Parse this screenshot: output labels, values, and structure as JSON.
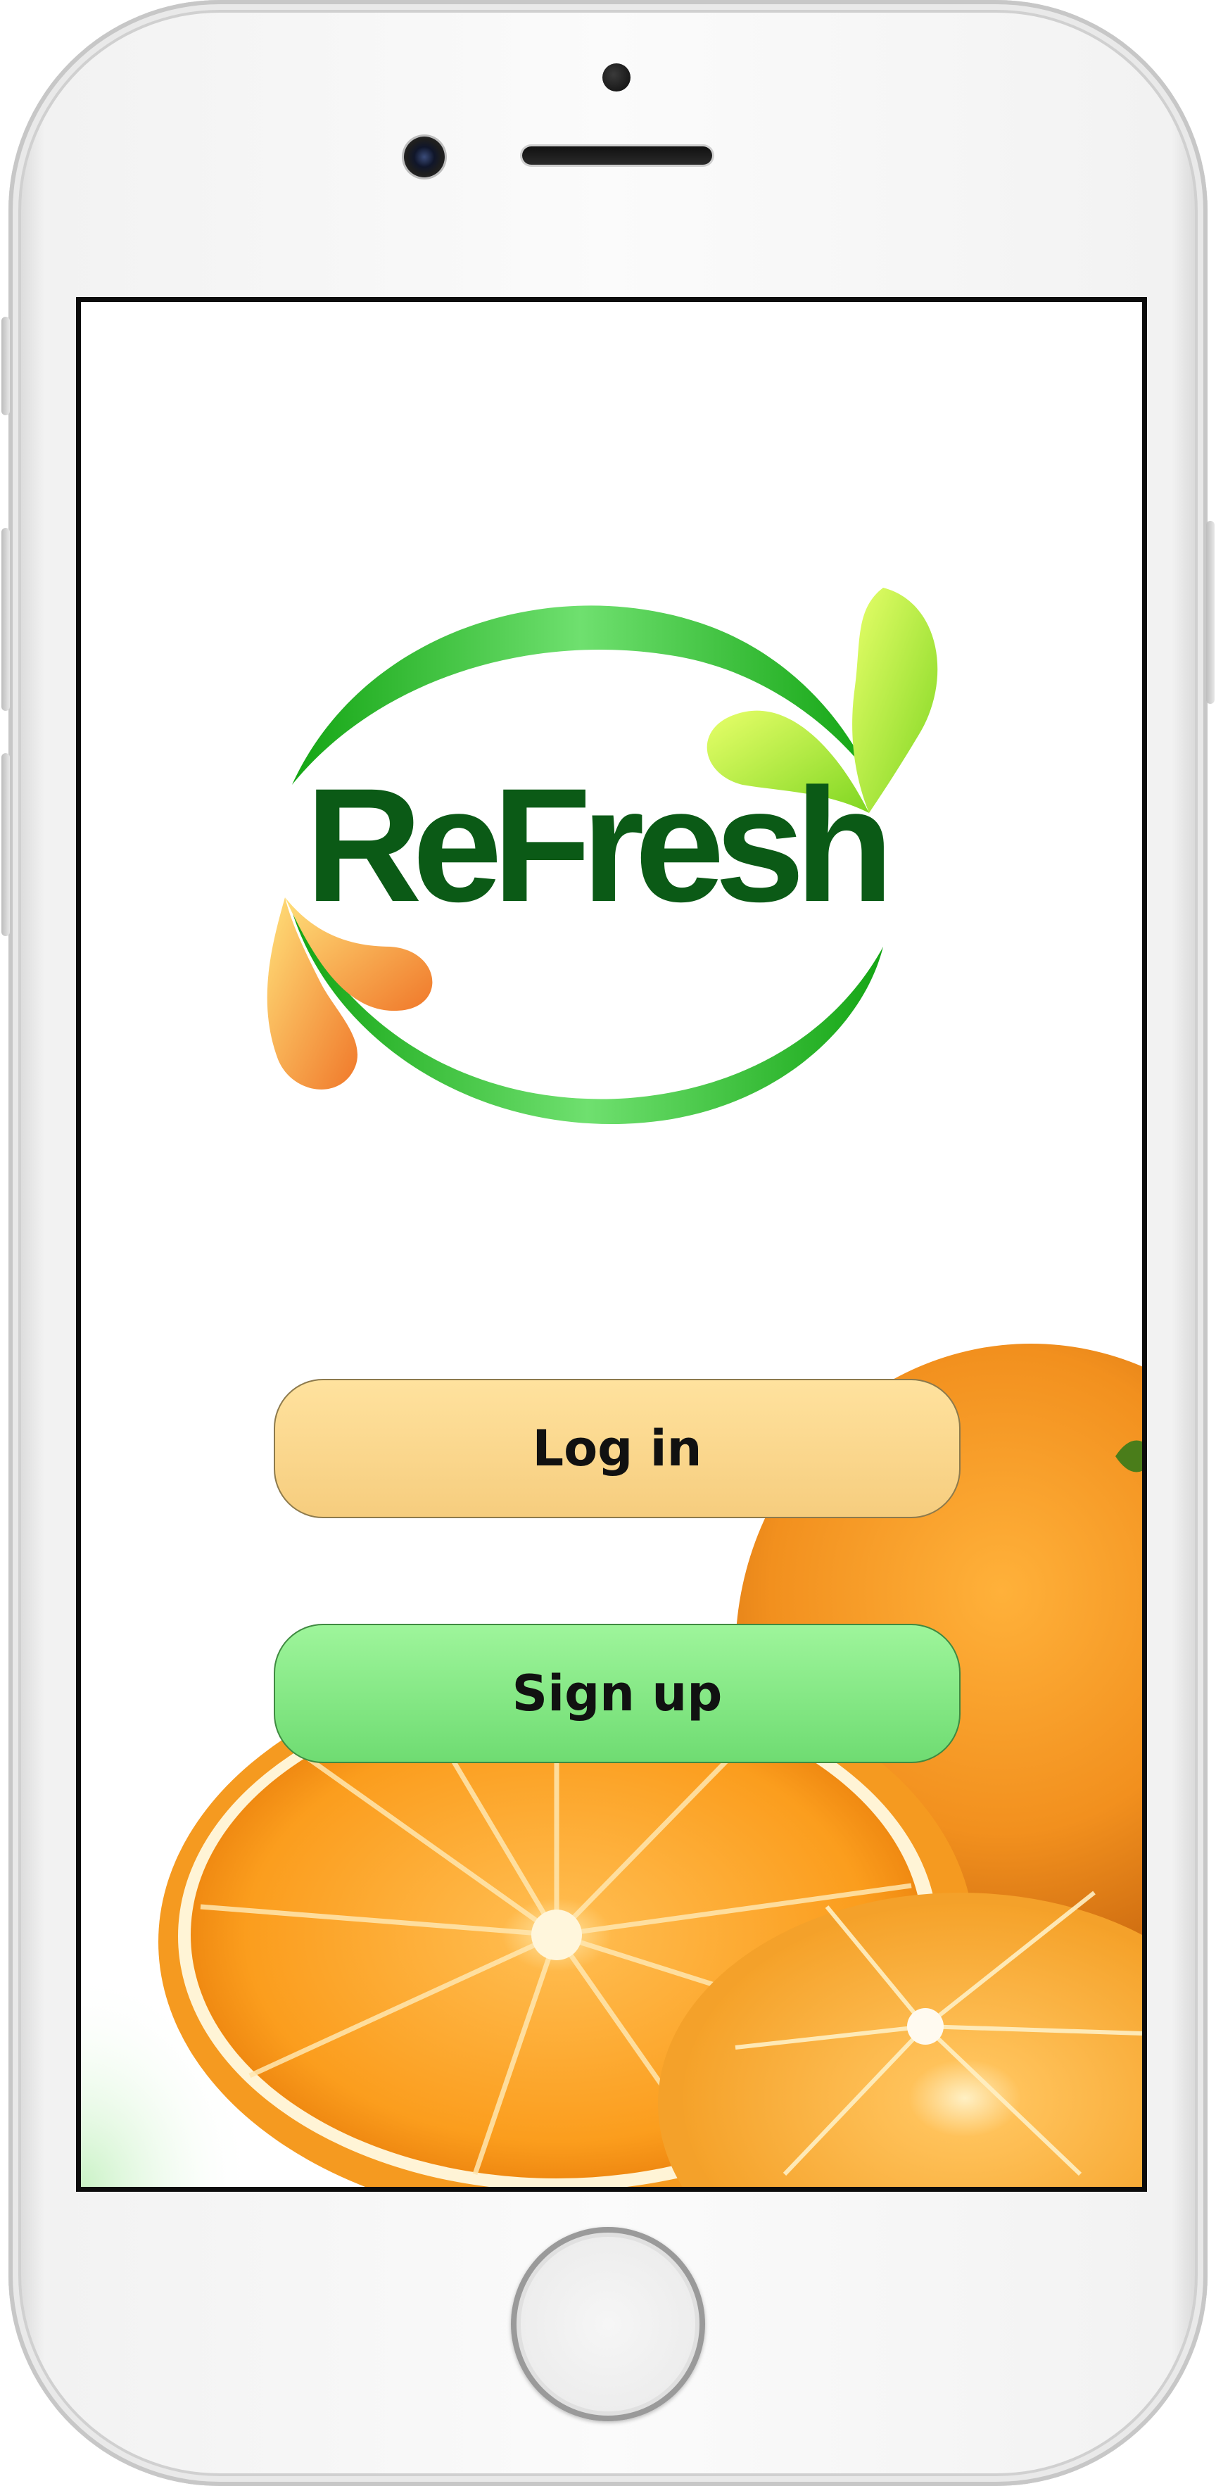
{
  "app": {
    "brand": "ReFresh"
  },
  "actions": {
    "login_label": "Log in",
    "signup_label": "Sign up"
  },
  "colors": {
    "brand_dark_green": "#0b4a12",
    "ring_green": "#2fbf2f",
    "drop_yellow_green": "#b6f23a",
    "drop_orange": "#f7a94a",
    "login_fill": "#fdd98c",
    "signup_fill": "#86e884"
  },
  "icons": {
    "logo": "refresh-logo",
    "background": "orange-halves-image"
  }
}
